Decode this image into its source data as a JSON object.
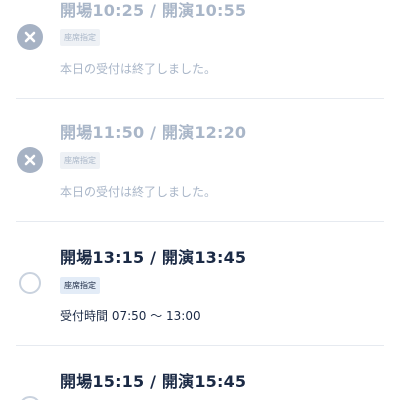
{
  "sessions": [
    {
      "time_label": "開場10:25 / 開演10:55",
      "seat_badge": "座席指定",
      "status_text": "本日の受付は終了しました。",
      "state": "closed"
    },
    {
      "time_label": "開場11:50 / 開演12:20",
      "seat_badge": "座席指定",
      "status_text": "本日の受付は終了しました。",
      "state": "closed"
    },
    {
      "time_label": "開場13:15 / 開演13:45",
      "seat_badge": "座席指定",
      "status_text": "受付時間 07:50 〜 13:00",
      "state": "open"
    },
    {
      "time_label": "開場15:15 / 開演15:45",
      "state": "open"
    }
  ]
}
